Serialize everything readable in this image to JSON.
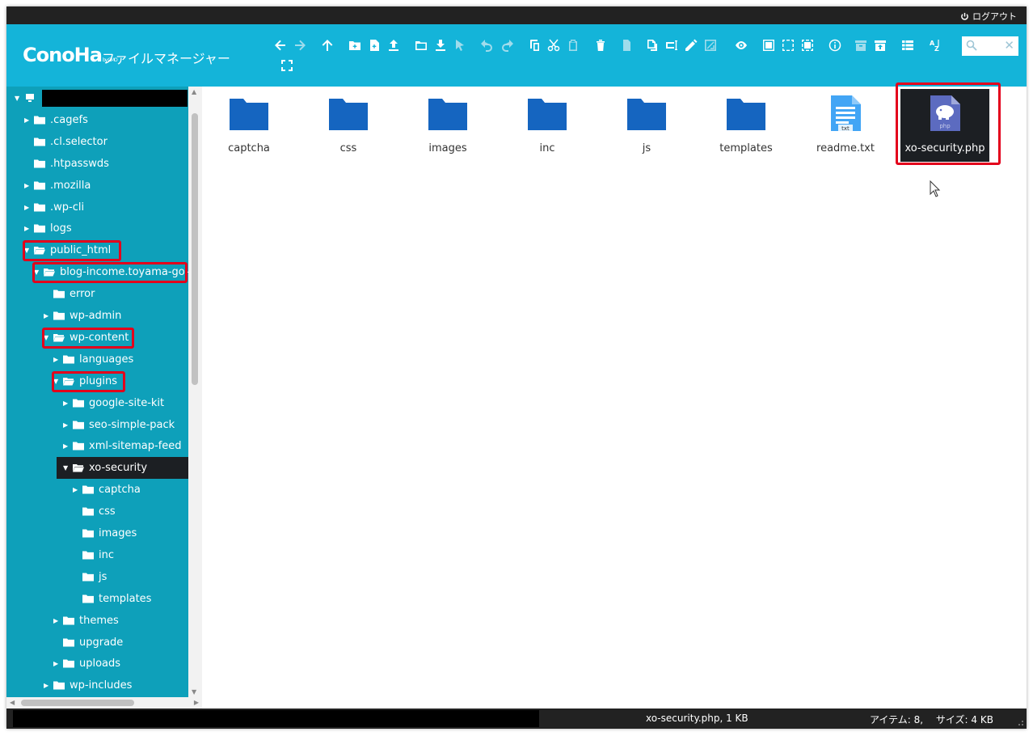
{
  "topbar": {
    "logout_label": "ログアウト"
  },
  "header": {
    "logo_text": "ConoHa",
    "logo_sub": "by GMO",
    "app_title": "ファイルマネージャー",
    "search_placeholder": ""
  },
  "tree": [
    {
      "label": "",
      "level": 0,
      "arrow": "open",
      "redacted": true
    },
    {
      "label": ".cagefs",
      "level": 1,
      "arrow": "closed"
    },
    {
      "label": ".cl.selector",
      "level": 1,
      "arrow": "none"
    },
    {
      "label": ".htpasswds",
      "level": 1,
      "arrow": "none"
    },
    {
      "label": ".mozilla",
      "level": 1,
      "arrow": "closed"
    },
    {
      "label": ".wp-cli",
      "level": 1,
      "arrow": "closed"
    },
    {
      "label": "logs",
      "level": 1,
      "arrow": "closed"
    },
    {
      "label": "public_html",
      "level": 1,
      "arrow": "open",
      "highlight": true
    },
    {
      "label": "blog-income.toyama-go-z-",
      "level": 2,
      "arrow": "open",
      "highlight": true
    },
    {
      "label": "error",
      "level": 3,
      "arrow": "none"
    },
    {
      "label": "wp-admin",
      "level": 3,
      "arrow": "closed"
    },
    {
      "label": "wp-content",
      "level": 3,
      "arrow": "open",
      "highlight": true
    },
    {
      "label": "languages",
      "level": 4,
      "arrow": "closed"
    },
    {
      "label": "plugins",
      "level": 4,
      "arrow": "open",
      "highlight": true
    },
    {
      "label": "google-site-kit",
      "level": 5,
      "arrow": "closed"
    },
    {
      "label": "seo-simple-pack",
      "level": 5,
      "arrow": "closed"
    },
    {
      "label": "xml-sitemap-feed",
      "level": 5,
      "arrow": "closed"
    },
    {
      "label": "xo-security",
      "level": 5,
      "arrow": "open",
      "selected": true
    },
    {
      "label": "captcha",
      "level": 6,
      "arrow": "closed"
    },
    {
      "label": "css",
      "level": 6,
      "arrow": "none"
    },
    {
      "label": "images",
      "level": 6,
      "arrow": "none"
    },
    {
      "label": "inc",
      "level": 6,
      "arrow": "none"
    },
    {
      "label": "js",
      "level": 6,
      "arrow": "none"
    },
    {
      "label": "templates",
      "level": 6,
      "arrow": "none"
    },
    {
      "label": "themes",
      "level": 4,
      "arrow": "closed"
    },
    {
      "label": "upgrade",
      "level": 4,
      "arrow": "none"
    },
    {
      "label": "uploads",
      "level": 4,
      "arrow": "closed"
    },
    {
      "label": "wp-includes",
      "level": 3,
      "arrow": "closed"
    }
  ],
  "files": [
    {
      "name": "captcha",
      "type": "folder"
    },
    {
      "name": "css",
      "type": "folder"
    },
    {
      "name": "images",
      "type": "folder"
    },
    {
      "name": "inc",
      "type": "folder"
    },
    {
      "name": "js",
      "type": "folder"
    },
    {
      "name": "templates",
      "type": "folder"
    },
    {
      "name": "readme.txt",
      "type": "txt",
      "badge": "txt"
    },
    {
      "name": "xo-security.php",
      "type": "php",
      "badge": "php",
      "selected": true
    }
  ],
  "status": {
    "file_info": "xo-security.php, 1 KB",
    "items": "アイテム: 8,　 サイズ: 4 KB"
  },
  "colors": {
    "header": "#14b4d9",
    "sidebar": "#0ea0ba",
    "folder": "#1565c0",
    "highlight": "#e3001b",
    "selected": "#1c1f23"
  }
}
